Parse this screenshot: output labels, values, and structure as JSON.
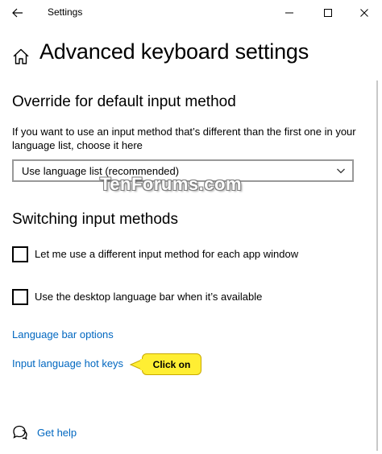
{
  "window": {
    "title": "Settings",
    "back_icon": "back-arrow-icon",
    "minimize_icon": "minimize-icon",
    "maximize_icon": "maximize-icon",
    "close_icon": "close-icon"
  },
  "header": {
    "home_icon": "home-icon",
    "title": "Advanced keyboard settings"
  },
  "override_section": {
    "title": "Override for default input method",
    "description": "If you want to use an input method that’s different than the first one in your language list, choose it here",
    "dropdown": {
      "selected": "Use language list (recommended)",
      "chevron_icon": "chevron-down-icon"
    }
  },
  "watermark": "TenForums.com",
  "switching_section": {
    "title": "Switching input methods",
    "checkboxes": [
      {
        "label": "Let me use a different input method for each app window",
        "checked": false
      },
      {
        "label": "Use the desktop language bar when it’s available",
        "checked": false
      }
    ]
  },
  "links": {
    "language_bar_options": "Language bar options",
    "input_language_hot_keys": "Input language hot keys"
  },
  "callout": {
    "label": "Click on",
    "color": "#ffee33"
  },
  "footer": {
    "help_icon": "get-help-icon",
    "help_label": "Get help"
  },
  "colors": {
    "link": "#0067c0",
    "text": "#000000",
    "background": "#ffffff"
  }
}
